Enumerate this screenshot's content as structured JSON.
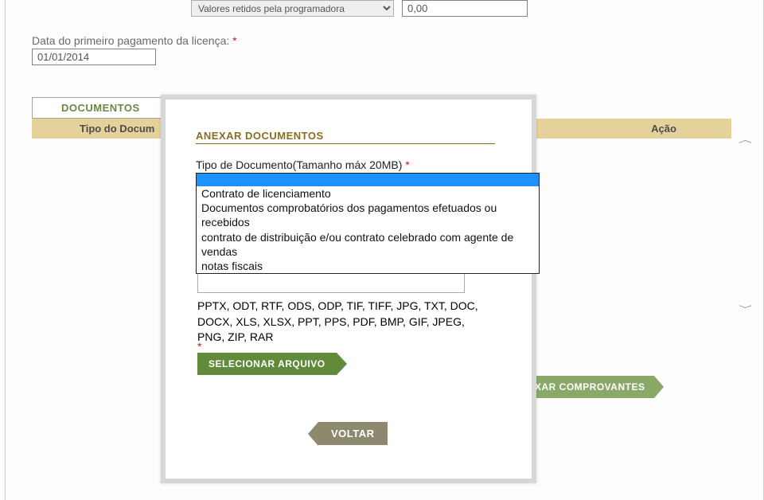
{
  "background": {
    "retention_dropdown": "Valores retidos pela programadora",
    "value_input": "0,00",
    "date_label": "Data do primeiro pagamento da licença:",
    "date_value": "01/01/2014",
    "tab_documentos": "DOCUMENTOS",
    "th_tipo": "Tipo do Docum",
    "th_acao": "Ação",
    "anexar_comprovantes": "XAR COMPROVANTES"
  },
  "modal": {
    "title": "ANEXAR DOCUMENTOS",
    "field_label": "Tipo de Documento(Tamanho máx 20MB)",
    "options": [
      "",
      "Contrato de licenciamento",
      "Documentos comprobatórios dos pagamentos efetuados ou recebidos",
      "contrato de distribuição e/ou contrato celebrado com agente de vendas",
      "notas fiscais"
    ],
    "formats": "PPTX, ODT, RTF, ODS, ODP, TIF, TIFF, JPG, TXT, DOC, DOCX, XLS, XLSX, PPT, PPS, PDF, BMP, GIF, JPEG, PNG, ZIP, RAR",
    "select_file": "SELECIONAR ARQUIVO",
    "voltar": "VOLTAR"
  }
}
